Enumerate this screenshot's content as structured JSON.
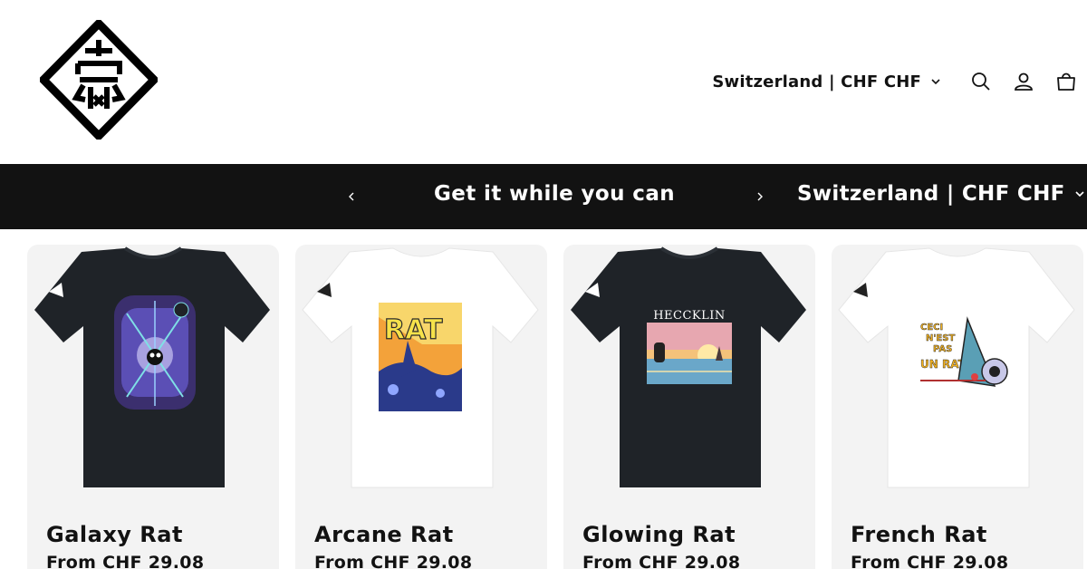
{
  "header": {
    "logo_name": "brand-logo",
    "country_selector": "Switzerland | CHF CHF",
    "icons": [
      "search-icon",
      "account-icon",
      "cart-icon"
    ]
  },
  "announcement": {
    "text": "Get it while you can",
    "country_selector": "Switzerland | CHF CHF"
  },
  "colors": {
    "bar_background": "#121212",
    "card_background": "#f3f3f3",
    "text": "#121212"
  },
  "products": [
    {
      "title": "Galaxy Rat",
      "price": "From CHF 29.08",
      "shirt_color": "#1f2328"
    },
    {
      "title": "Arcane Rat",
      "price": "From CHF 29.08",
      "shirt_color": "#ffffff"
    },
    {
      "title": "Glowing Rat",
      "price": "From CHF 29.08",
      "shirt_color": "#1f2328",
      "print_text": "HECCKLIN"
    },
    {
      "title": "French Rat",
      "price": "From CHF 29.08",
      "shirt_color": "#ffffff"
    }
  ]
}
